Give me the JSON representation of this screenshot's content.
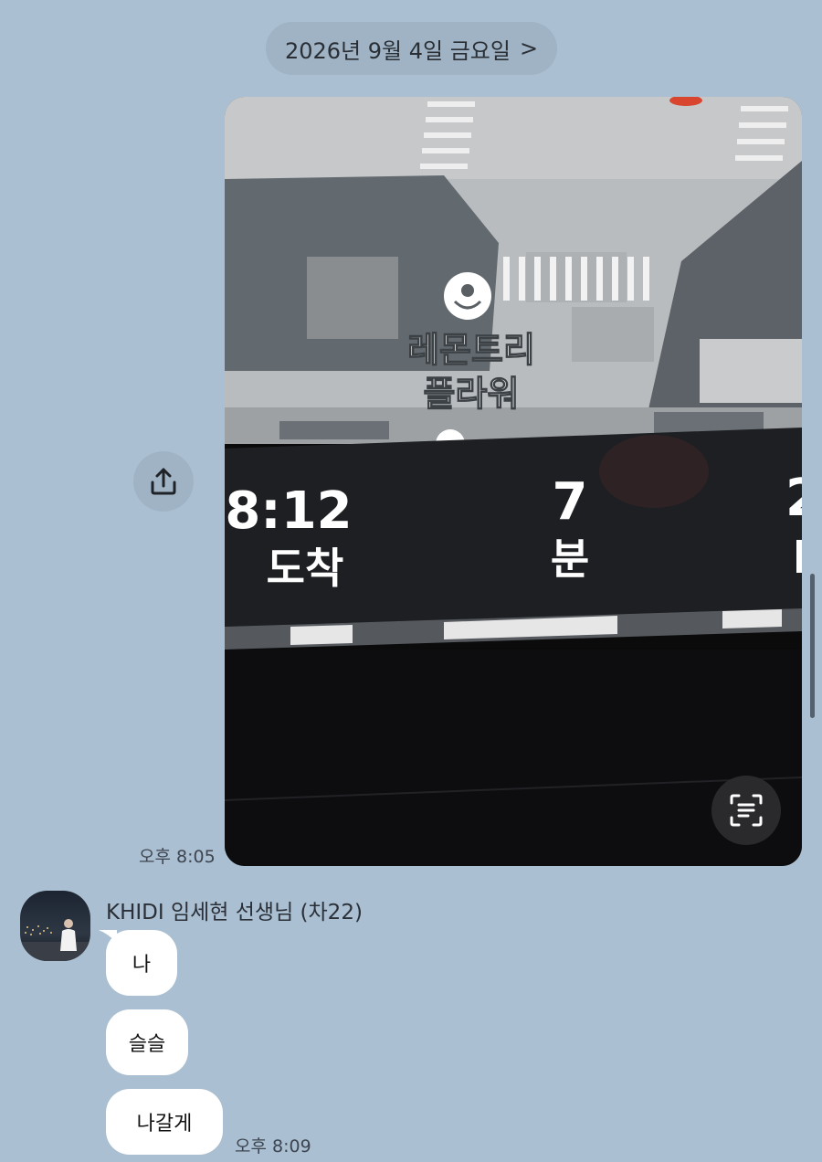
{
  "date_divider": {
    "label": "2026년 9월 4일 금요일",
    "chevron": ">"
  },
  "messages": {
    "photo": {
      "time": "오후 8:05",
      "map_place_label_line1": "레몬트리",
      "map_place_label_line2": "플라워",
      "arrival_time": "8:12",
      "arrival_label": "도착",
      "minutes_value": "7",
      "minutes_label": "분",
      "share_icon": "share-icon",
      "scan_icon": "text-scan-icon"
    },
    "sender": {
      "name": "KHIDI 임세현 선생님 (차22)",
      "bubbles": [
        "나",
        "슬슬",
        "나갈게"
      ],
      "time": "오후 8:09"
    }
  },
  "colors": {
    "background": "#aabfd1",
    "bubble": "#ffffff",
    "pill": "#9fb3c5"
  }
}
